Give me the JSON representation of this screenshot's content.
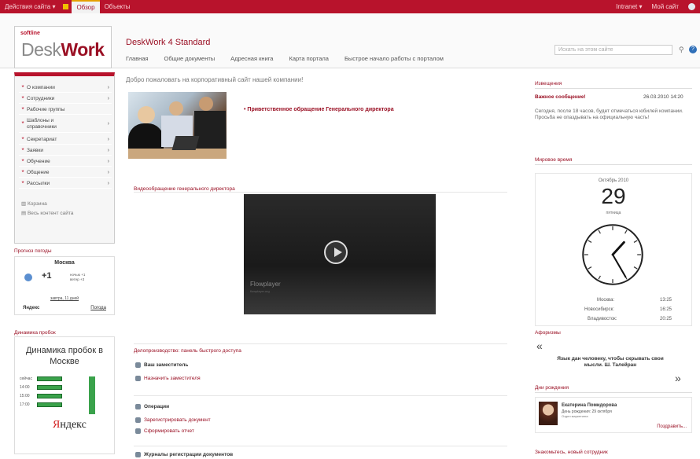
{
  "topbar": {
    "tab1": "Действия сайта ▾",
    "tab2": "Обзор",
    "tab3": "Объекты",
    "user": "Intranet ▾",
    "mysite": "Мой сайт"
  },
  "header": {
    "logo_small": "softline",
    "logo_desk": "Desk",
    "logo_work": "Work",
    "site_title": "DeskWork 4 Standard",
    "search_placeholder": "Искать на этом сайте",
    "nav": [
      "Главная",
      "Общие документы",
      "Адресная книга",
      "Карта портала",
      "Быстрое начало работы с порталом"
    ]
  },
  "sidebar": {
    "items": [
      {
        "label": "О компании",
        "arrow": "›"
      },
      {
        "label": "Сотрудники",
        "arrow": "›"
      },
      {
        "label": "Рабочие группы",
        "arrow": ""
      },
      {
        "label": "Шаблоны и справочники",
        "arrow": "›"
      },
      {
        "label": "Секретариат",
        "arrow": "›"
      },
      {
        "label": "Заявки",
        "arrow": "›"
      },
      {
        "label": "Обучение",
        "arrow": "›"
      },
      {
        "label": "Общение",
        "arrow": "›"
      },
      {
        "label": "Рассылки",
        "arrow": "›"
      }
    ],
    "links": [
      "Корзина",
      "Весь контент сайта"
    ]
  },
  "weather": {
    "header": "Прогноз погоды",
    "city": "Москва",
    "temp": "+1",
    "details": "ночью +1\nветер +3",
    "updated": "завтра, 11 дней",
    "yandex": "Яндекс",
    "more": "Погода"
  },
  "traffic": {
    "header": "Динамика пробок",
    "title": "Динамика пробок в Москве",
    "rows": [
      {
        "time": "сейчас",
        "level": 0.8
      },
      {
        "time": "14:00",
        "level": 0.8
      },
      {
        "time": "15:00",
        "level": 0.8
      },
      {
        "time": "17:00",
        "level": 0.8
      }
    ],
    "y_text": "Я",
    "yandex_rest": "ндекс"
  },
  "main": {
    "greeting": "Добро пожаловать на корпоративный сайт нашей компании!",
    "director_link": "Приветственное обращение Генерального директора",
    "video_header": "Видеообращение генерального директора",
    "flowplayer": "Flowplayer",
    "flowplayer_sub": "flowplayer.org",
    "qa_header": "Делопроизводство: панель быстрого доступа",
    "qa": [
      {
        "label": "Ваш заместитель",
        "kind": "h"
      },
      {
        "label": "Назначить заместителя",
        "kind": "l"
      },
      {
        "label": "Операции",
        "kind": "h"
      },
      {
        "label": "Зарегистрировать документ",
        "kind": "l"
      },
      {
        "label": "Сформировать отчет",
        "kind": "l"
      },
      {
        "label": "Журналы регистрации документов",
        "kind": "h"
      }
    ]
  },
  "right": {
    "ann_header": "Извещения",
    "ann_title": "Важное сообщение!",
    "ann_date": "26.03.2010 14:20",
    "ann_text": "Сегодня, после 18 часов, будет отмечаться юбилей компании. Просьба не опаздывать на официальную часть!",
    "clock_header": "Мировое время",
    "cal_month": "Октябрь 2010",
    "cal_day": "29",
    "cal_weekday": "пятница",
    "clock_hour": 1,
    "clock_minute": 25,
    "timezones": [
      {
        "city": "Москва:",
        "time": "13:25"
      },
      {
        "city": "Новосибирск:",
        "time": "16:25"
      },
      {
        "city": "Владивосток:",
        "time": "20:25"
      }
    ],
    "aphorism_header": "Афоризмы",
    "quote": "Язык дан человеку, чтобы скрывать свои мысли. Ш. Талейран",
    "bday_header": "Дни рождения",
    "bday_name": "Екатерина Помидорова",
    "bday_info": "День рождения: 29 октября",
    "bday_info2": "Отдел маркетинга",
    "bday_link": "Поздравить...",
    "newemp_header": "Знакомьтесь, новый сотрудник"
  }
}
